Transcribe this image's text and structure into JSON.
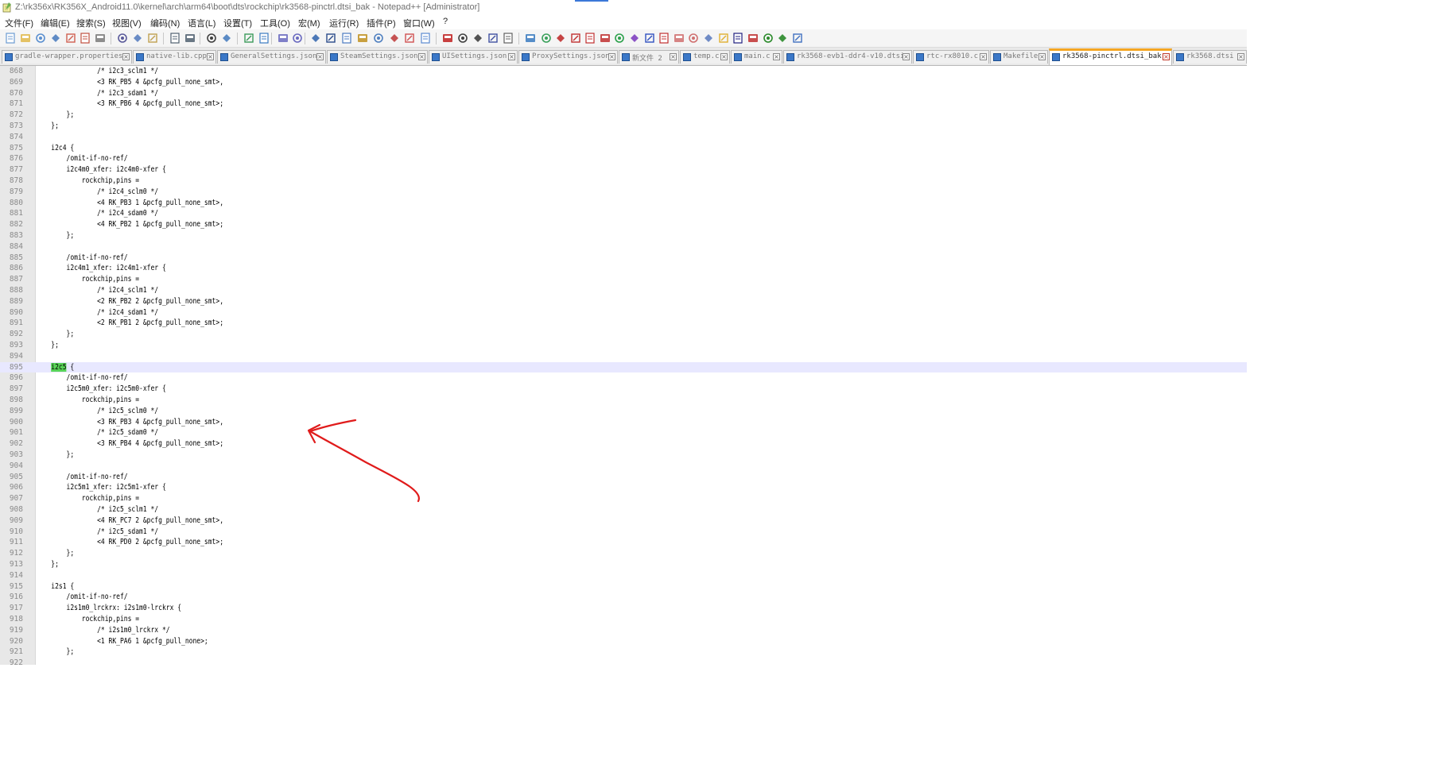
{
  "window": {
    "title": "Z:\\rk356x\\RK356X_Android11.0\\kernel\\arch\\arm64\\boot\\dts\\rockchip\\rk3568-pinctrl.dtsi_bak - Notepad++ [Administrator]"
  },
  "menu": [
    "文件(F)",
    "编辑(E)",
    "搜索(S)",
    "视图(V)",
    "编码(N)",
    "语言(L)",
    "设置(T)",
    "工具(O)",
    "宏(M)",
    "运行(R)",
    "插件(P)",
    "窗口(W)",
    "?"
  ],
  "toolbar_icons": [
    "new-file-icon",
    "open-file-icon",
    "save-icon",
    "save-all-icon",
    "close-icon",
    "close-all-icon",
    "print-icon",
    "cut-icon",
    "copy-icon",
    "paste-icon",
    "undo-icon",
    "redo-icon",
    "find-icon",
    "replace-icon",
    "zoom-in-icon",
    "zoom-out-icon",
    "sync-vertical-icon",
    "sync-horizontal-icon",
    "word-wrap-icon",
    "show-all-chars-icon",
    "indent-guide-icon",
    "udl-icon",
    "doc-map-icon",
    "function-list-icon",
    "folder-as-workspace-icon",
    "monitoring-icon",
    "record-macro-icon",
    "stop-macro-icon",
    "play-macro-icon",
    "run-macro-multiple-icon",
    "save-macro-icon",
    "plugin-1-icon",
    "plugin-2-icon",
    "plugin-3-icon",
    "plugin-4-icon",
    "plugin-5-icon",
    "plugin-6-icon",
    "plugin-7-icon",
    "plugin-8-icon",
    "plugin-9-icon",
    "plugin-10-icon",
    "plugin-11-icon",
    "plugin-12-icon",
    "plugin-13-icon",
    "plugin-14-icon",
    "plugin-15-icon",
    "plugin-16-icon",
    "plugin-17-icon",
    "plugin-18-icon",
    "plugin-19-icon"
  ],
  "tabs": [
    {
      "label": "gradle-wrapper.properties",
      "active": false
    },
    {
      "label": "native-lib.cpp",
      "active": false
    },
    {
      "label": "GeneralSettings.json",
      "active": false
    },
    {
      "label": "SteamSettings.json",
      "active": false
    },
    {
      "label": "UISettings.json",
      "active": false
    },
    {
      "label": "ProxySettings.json",
      "active": false
    },
    {
      "label": "新文件 2",
      "active": false
    },
    {
      "label": "temp.c",
      "active": false
    },
    {
      "label": "main.c",
      "active": false
    },
    {
      "label": "rk3568-evb1-ddr4-v10.dtsi",
      "active": false
    },
    {
      "label": "rtc-rx8010.c",
      "active": false
    },
    {
      "label": "Makefile",
      "active": false
    },
    {
      "label": "rk3568-pinctrl.dtsi_bak",
      "active": true
    },
    {
      "label": "rk3568.dtsi",
      "active": false
    }
  ],
  "editor": {
    "current_line": 895,
    "highlight_word": "i2c5",
    "lines": [
      {
        "n": "868",
        "t": "\t\t\t\t/* i2c3_sclm1 */"
      },
      {
        "n": "869",
        "t": "\t\t\t\t<3 RK_PB5 4 &pcfg_pull_none_smt>,"
      },
      {
        "n": "870",
        "t": "\t\t\t\t/* i2c3_sdam1 */"
      },
      {
        "n": "871",
        "t": "\t\t\t\t<3 RK_PB6 4 &pcfg_pull_none_smt>;"
      },
      {
        "n": "872",
        "t": "\t\t};"
      },
      {
        "n": "873",
        "t": "\t};"
      },
      {
        "n": "874",
        "t": ""
      },
      {
        "n": "875",
        "t": "\ti2c4 {"
      },
      {
        "n": "876",
        "t": "\t\t/omit-if-no-ref/"
      },
      {
        "n": "877",
        "t": "\t\ti2c4m0_xfer: i2c4m0-xfer {"
      },
      {
        "n": "878",
        "t": "\t\t\trockchip,pins ="
      },
      {
        "n": "879",
        "t": "\t\t\t\t/* i2c4_sclm0 */"
      },
      {
        "n": "880",
        "t": "\t\t\t\t<4 RK_PB3 1 &pcfg_pull_none_smt>,"
      },
      {
        "n": "881",
        "t": "\t\t\t\t/* i2c4_sdam0 */"
      },
      {
        "n": "882",
        "t": "\t\t\t\t<4 RK_PB2 1 &pcfg_pull_none_smt>;"
      },
      {
        "n": "883",
        "t": "\t\t};"
      },
      {
        "n": "884",
        "t": ""
      },
      {
        "n": "885",
        "t": "\t\t/omit-if-no-ref/"
      },
      {
        "n": "886",
        "t": "\t\ti2c4m1_xfer: i2c4m1-xfer {"
      },
      {
        "n": "887",
        "t": "\t\t\trockchip,pins ="
      },
      {
        "n": "888",
        "t": "\t\t\t\t/* i2c4_sclm1 */"
      },
      {
        "n": "889",
        "t": "\t\t\t\t<2 RK_PB2 2 &pcfg_pull_none_smt>,"
      },
      {
        "n": "890",
        "t": "\t\t\t\t/* i2c4_sdam1 */"
      },
      {
        "n": "891",
        "t": "\t\t\t\t<2 RK_PB1 2 &pcfg_pull_none_smt>;"
      },
      {
        "n": "892",
        "t": "\t\t};"
      },
      {
        "n": "893",
        "t": "\t};"
      },
      {
        "n": "894",
        "t": ""
      },
      {
        "n": "895",
        "t": "\ti2c5 {"
      },
      {
        "n": "896",
        "t": "\t\t/omit-if-no-ref/"
      },
      {
        "n": "897",
        "t": "\t\ti2c5m0_xfer: i2c5m0-xfer {"
      },
      {
        "n": "898",
        "t": "\t\t\trockchip,pins ="
      },
      {
        "n": "899",
        "t": "\t\t\t\t/* i2c5_sclm0 */"
      },
      {
        "n": "900",
        "t": "\t\t\t\t<3 RK_PB3 4 &pcfg_pull_none_smt>,"
      },
      {
        "n": "901",
        "t": "\t\t\t\t/* i2c5_sdam0 */"
      },
      {
        "n": "902",
        "t": "\t\t\t\t<3 RK_PB4 4 &pcfg_pull_none_smt>;"
      },
      {
        "n": "903",
        "t": "\t\t};"
      },
      {
        "n": "904",
        "t": ""
      },
      {
        "n": "905",
        "t": "\t\t/omit-if-no-ref/"
      },
      {
        "n": "906",
        "t": "\t\ti2c5m1_xfer: i2c5m1-xfer {"
      },
      {
        "n": "907",
        "t": "\t\t\trockchip,pins ="
      },
      {
        "n": "908",
        "t": "\t\t\t\t/* i2c5_sclm1 */"
      },
      {
        "n": "909",
        "t": "\t\t\t\t<4 RK_PC7 2 &pcfg_pull_none_smt>,"
      },
      {
        "n": "910",
        "t": "\t\t\t\t/* i2c5_sdam1 */"
      },
      {
        "n": "911",
        "t": "\t\t\t\t<4 RK_PD0 2 &pcfg_pull_none_smt>;"
      },
      {
        "n": "912",
        "t": "\t\t};"
      },
      {
        "n": "913",
        "t": "\t};"
      },
      {
        "n": "914",
        "t": ""
      },
      {
        "n": "915",
        "t": "\ti2s1 {"
      },
      {
        "n": "916",
        "t": "\t\t/omit-if-no-ref/"
      },
      {
        "n": "917",
        "t": "\t\ti2s1m0_lrckrx: i2s1m0-lrckrx {"
      },
      {
        "n": "918",
        "t": "\t\t\trockchip,pins ="
      },
      {
        "n": "919",
        "t": "\t\t\t\t/* i2s1m0_lrckrx */"
      },
      {
        "n": "920",
        "t": "\t\t\t\t<1 RK_PA6 1 &pcfg_pull_none>;"
      },
      {
        "n": "921",
        "t": "\t\t};"
      },
      {
        "n": "922",
        "t": ""
      }
    ]
  }
}
